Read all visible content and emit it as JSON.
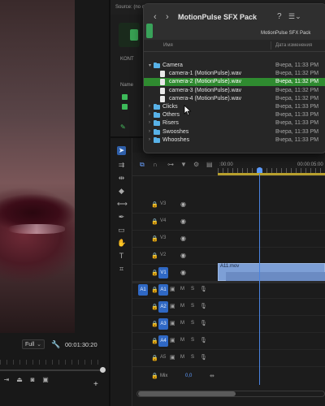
{
  "monitor": {
    "zoom": "Full",
    "timecode": "00:01:30:20",
    "add_label": "+"
  },
  "source_panel": {
    "label": "Source: (no c",
    "kont_label": "KONT",
    "name_label": "Name"
  },
  "finder": {
    "title": "MotionPulse SFX Pack",
    "path_label": "MotionPulse SFX Pack",
    "col_name": "Имя",
    "col_date": "Дата изменения",
    "rows": [
      {
        "type": "folder",
        "expanded": true,
        "name": "Camera",
        "date": "Вчера, 11:33 PM",
        "selected": false
      },
      {
        "type": "file",
        "name": "camera-1 (MotionPulse).wav",
        "date": "Вчера, 11:32 PM",
        "selected": false
      },
      {
        "type": "file",
        "name": "camera-2 (MotionPulse).wav",
        "date": "Вчера, 11:32 PM",
        "selected": true
      },
      {
        "type": "file",
        "name": "camera-3 (MotionPulse).wav",
        "date": "Вчера, 11:32 PM",
        "selected": false
      },
      {
        "type": "file",
        "name": "camera-4 (MotionPulse).wav",
        "date": "Вчера, 11:32 PM",
        "selected": false
      },
      {
        "type": "folder",
        "expanded": false,
        "name": "Clicks",
        "date": "Вчера, 11:33 PM",
        "selected": false
      },
      {
        "type": "folder",
        "expanded": false,
        "name": "Others",
        "date": "Вчера, 11:33 PM",
        "selected": false
      },
      {
        "type": "folder",
        "expanded": false,
        "name": "Risers",
        "date": "Вчера, 11:33 PM",
        "selected": false
      },
      {
        "type": "folder",
        "expanded": false,
        "name": "Swooshes",
        "date": "Вчера, 11:33 PM",
        "selected": false
      },
      {
        "type": "folder",
        "expanded": false,
        "name": "Whooshes",
        "date": "Вчера, 11:33 PM",
        "selected": false
      }
    ],
    "selection_color": "#2f8b30"
  },
  "timeline": {
    "ruler_start": ":00:00",
    "ruler_mid": "00:00:05:00",
    "video_tracks": [
      "V3",
      "V4",
      "V3",
      "V2",
      "V1"
    ],
    "audio_tracks": [
      "A1",
      "A2",
      "A3",
      "A4",
      "A5"
    ],
    "source_patch": "A1",
    "mute_label": "M",
    "solo_label": "S",
    "mix_label": "Mix",
    "mix_value": "0,0",
    "clip_label": "A11.mov",
    "accent": "#2f68c4"
  }
}
